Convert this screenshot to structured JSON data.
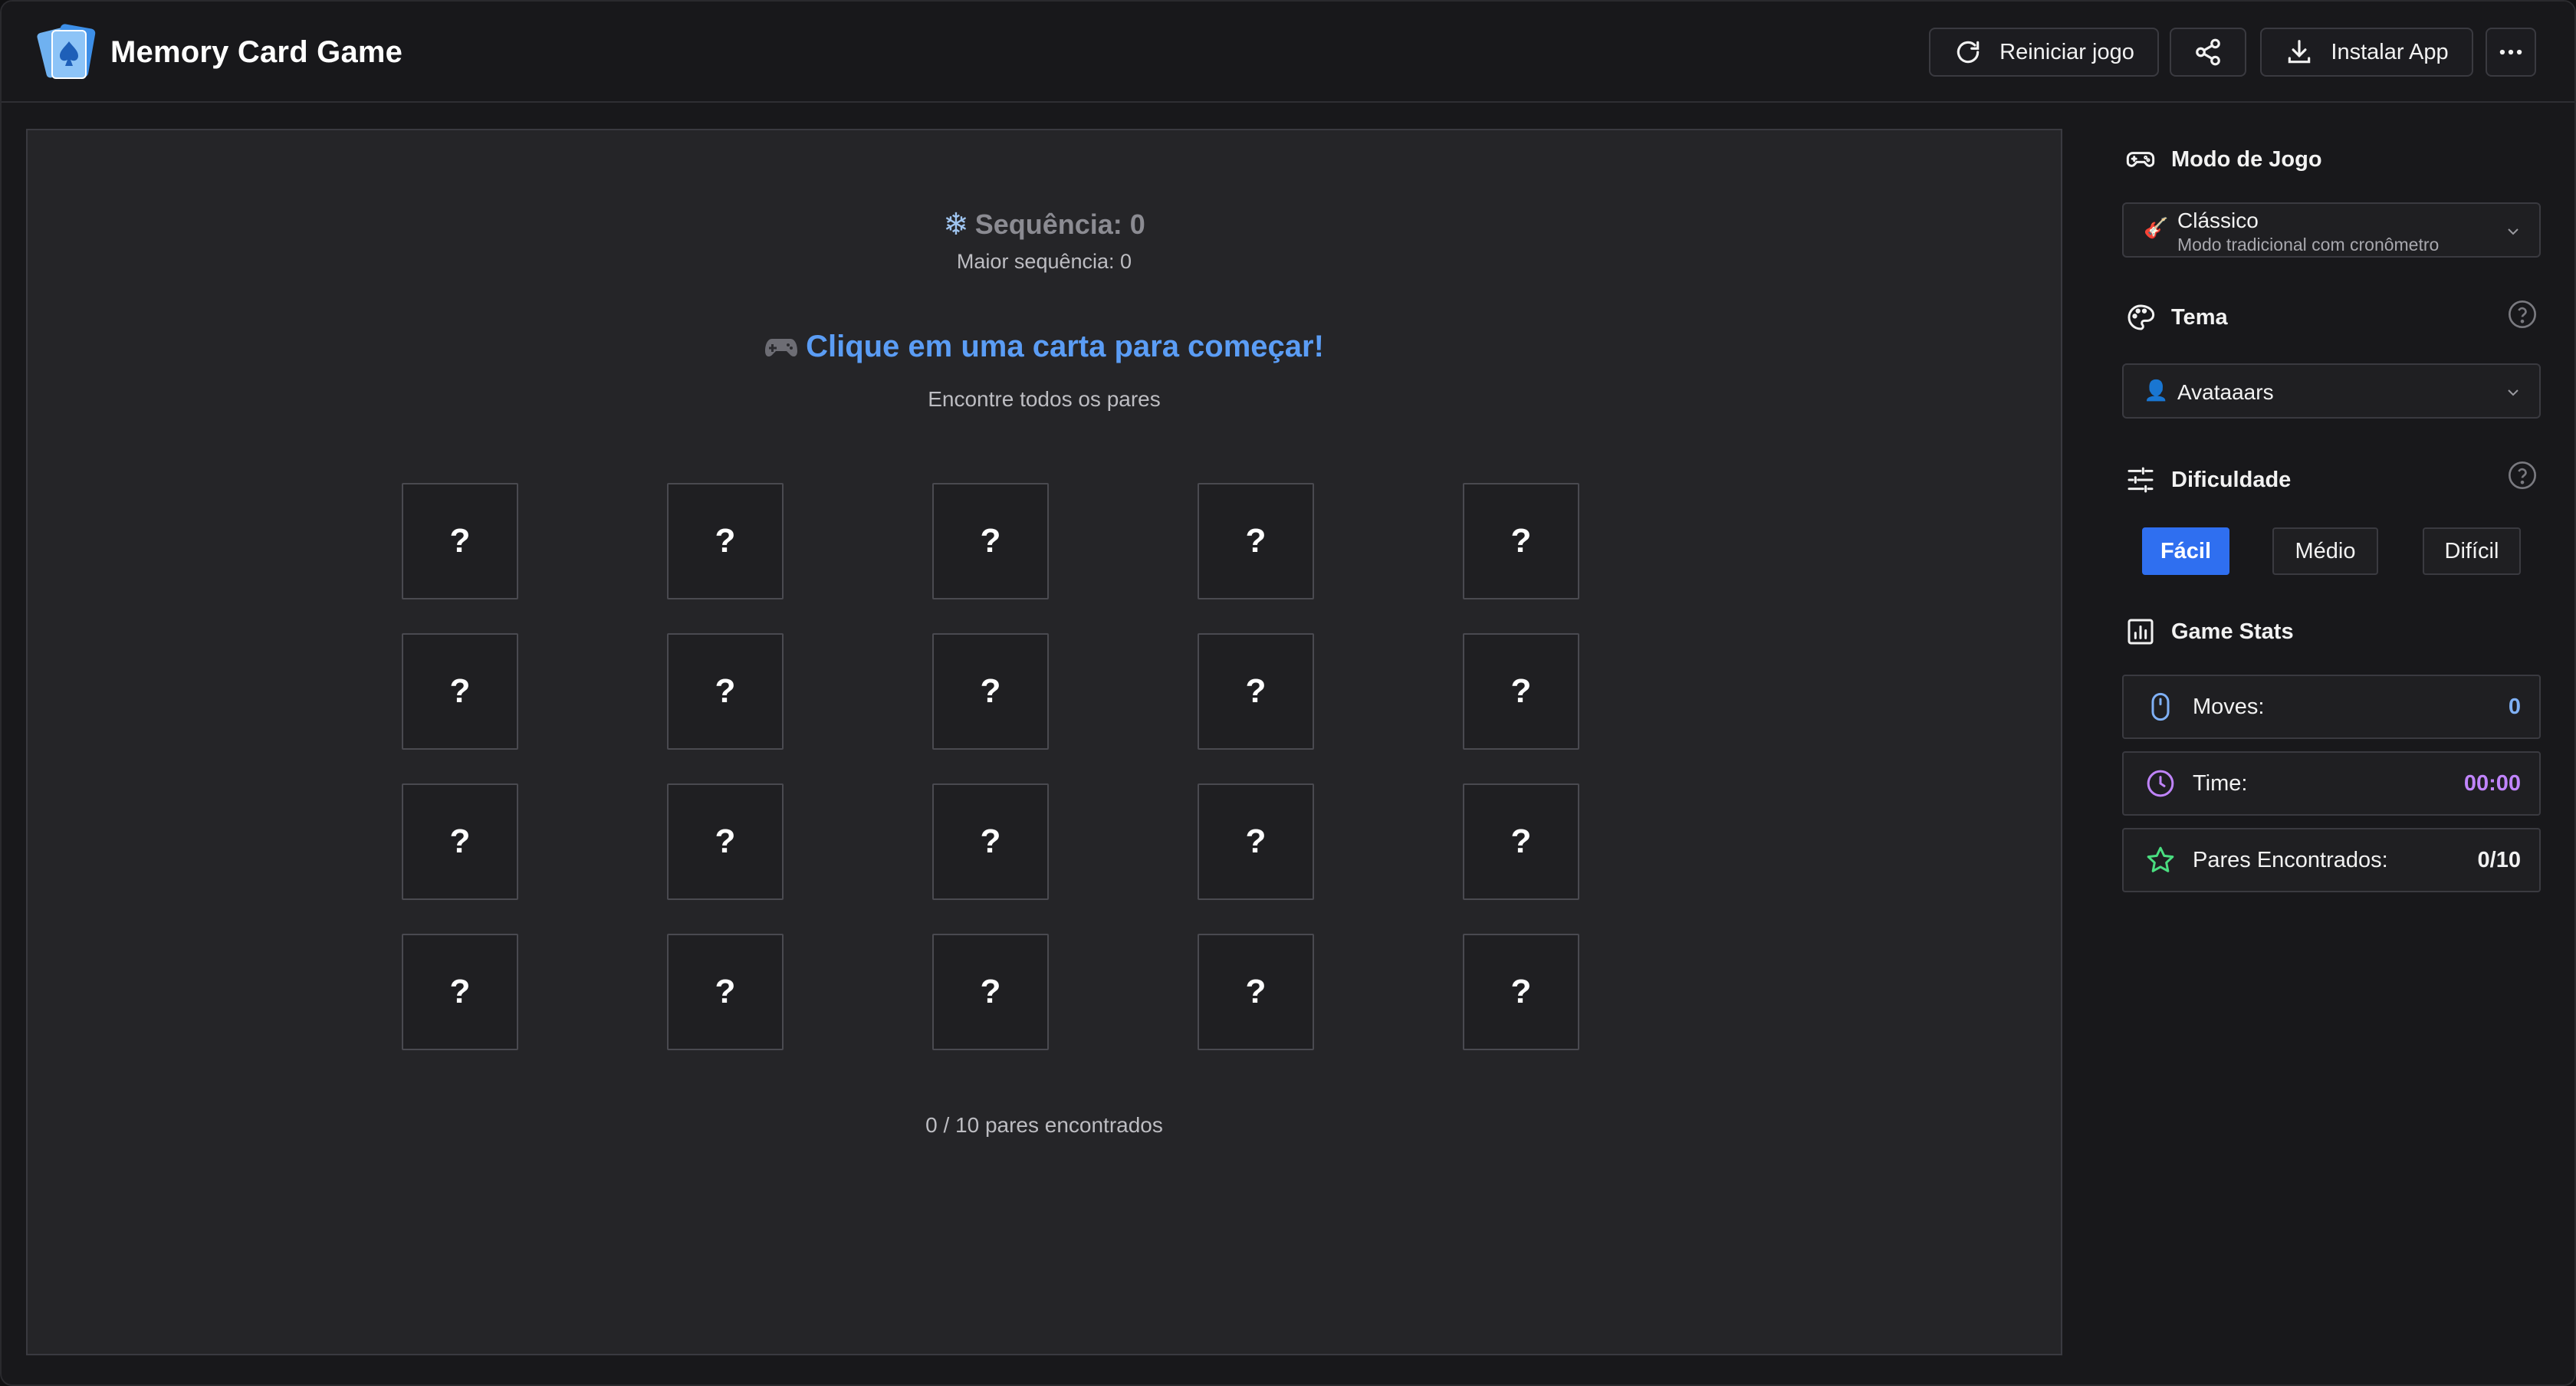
{
  "header": {
    "title": "Memory Card Game",
    "restart_label": "Reiniciar jogo",
    "install_label": "Instalar App"
  },
  "game": {
    "streak_label": "Sequência: 0",
    "best_streak_label": "Maior sequência: 0",
    "prompt_title": "Clique em uma carta para começar!",
    "prompt_subtitle": "Encontre todos os pares",
    "card_back": "?",
    "card_count": 20,
    "pairs_found_label": "0 / 10 pares encontrados"
  },
  "sidebar": {
    "mode": {
      "title": "Modo de Jogo",
      "selected": "Clássico",
      "description": "Modo tradicional com cronômetro"
    },
    "theme": {
      "title": "Tema",
      "selected": "Avataaars"
    },
    "difficulty": {
      "title": "Dificuldade",
      "options": [
        "Fácil",
        "Médio",
        "Difícil"
      ],
      "selected": "Fácil"
    },
    "stats": {
      "title": "Game Stats",
      "moves_label": "Moves:",
      "moves_value": "0",
      "time_label": "Time:",
      "time_value": "00:00",
      "pairs_label": "Pares Encontrados:",
      "pairs_value": "0/10"
    }
  },
  "colors": {
    "accent_blue": "#5b9df5",
    "active_button": "#2f6ff0",
    "moves_value": "#7fb0f5",
    "time_value": "#c084fc",
    "pairs_icon": "#4ade80"
  }
}
